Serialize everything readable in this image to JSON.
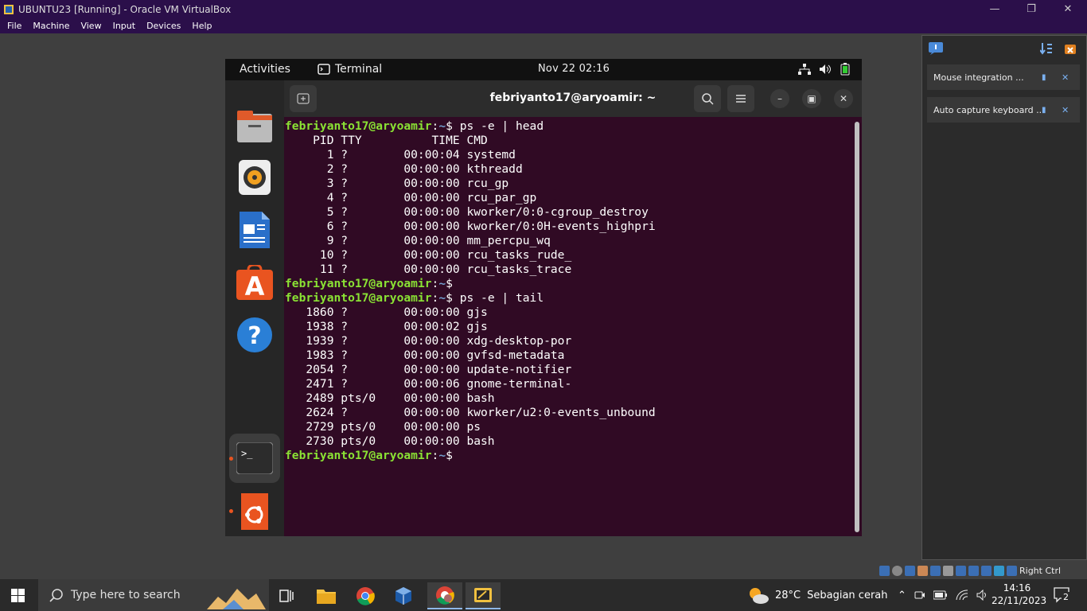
{
  "window": {
    "title": "UBUNTU23 [Running] - Oracle VM VirtualBox"
  },
  "menu": [
    "File",
    "Machine",
    "View",
    "Input",
    "Devices",
    "Help"
  ],
  "gnome": {
    "activities": "Activities",
    "app_label": "Terminal",
    "clock": "Nov 22  02:16"
  },
  "terminal": {
    "title": "febriyanto17@aryoamir: ~",
    "prompt_user": "febriyanto17@aryoamir",
    "prompt_sep": ":",
    "prompt_path": "~",
    "prompt_sym": "$",
    "cmd1": " ps -e | head",
    "head_lines": [
      "    PID TTY          TIME CMD",
      "      1 ?        00:00:04 systemd",
      "      2 ?        00:00:00 kthreadd",
      "      3 ?        00:00:00 rcu_gp",
      "      4 ?        00:00:00 rcu_par_gp",
      "      5 ?        00:00:00 kworker/0:0-cgroup_destroy",
      "      6 ?        00:00:00 kworker/0:0H-events_highpri",
      "      9 ?        00:00:00 mm_percpu_wq",
      "     10 ?        00:00:00 rcu_tasks_rude_",
      "     11 ?        00:00:00 rcu_tasks_trace"
    ],
    "cmd2": "",
    "cmd3": " ps -e | tail",
    "tail_lines": [
      "   1860 ?        00:00:00 gjs",
      "   1938 ?        00:00:02 gjs",
      "   1939 ?        00:00:00 xdg-desktop-por",
      "   1983 ?        00:00:00 gvfsd-metadata",
      "   2054 ?        00:00:00 update-notifier",
      "   2471 ?        00:00:06 gnome-terminal-",
      "   2489 pts/0    00:00:00 bash",
      "   2624 ?        00:00:00 kworker/u2:0-events_unbound",
      "   2729 pts/0    00:00:00 ps",
      "   2730 pts/0    00:00:00 bash"
    ],
    "cmd4": ""
  },
  "vb_notifications": [
    "Mouse integration ...",
    "Auto capture keyboard ..."
  ],
  "vb_status": {
    "host_key": "Right Ctrl"
  },
  "taskbar": {
    "search_placeholder": "Type here to search",
    "temp": "28°C",
    "weather": "Sebagian cerah",
    "time": "14:16",
    "date": "22/11/2023",
    "notif_count": "2"
  }
}
